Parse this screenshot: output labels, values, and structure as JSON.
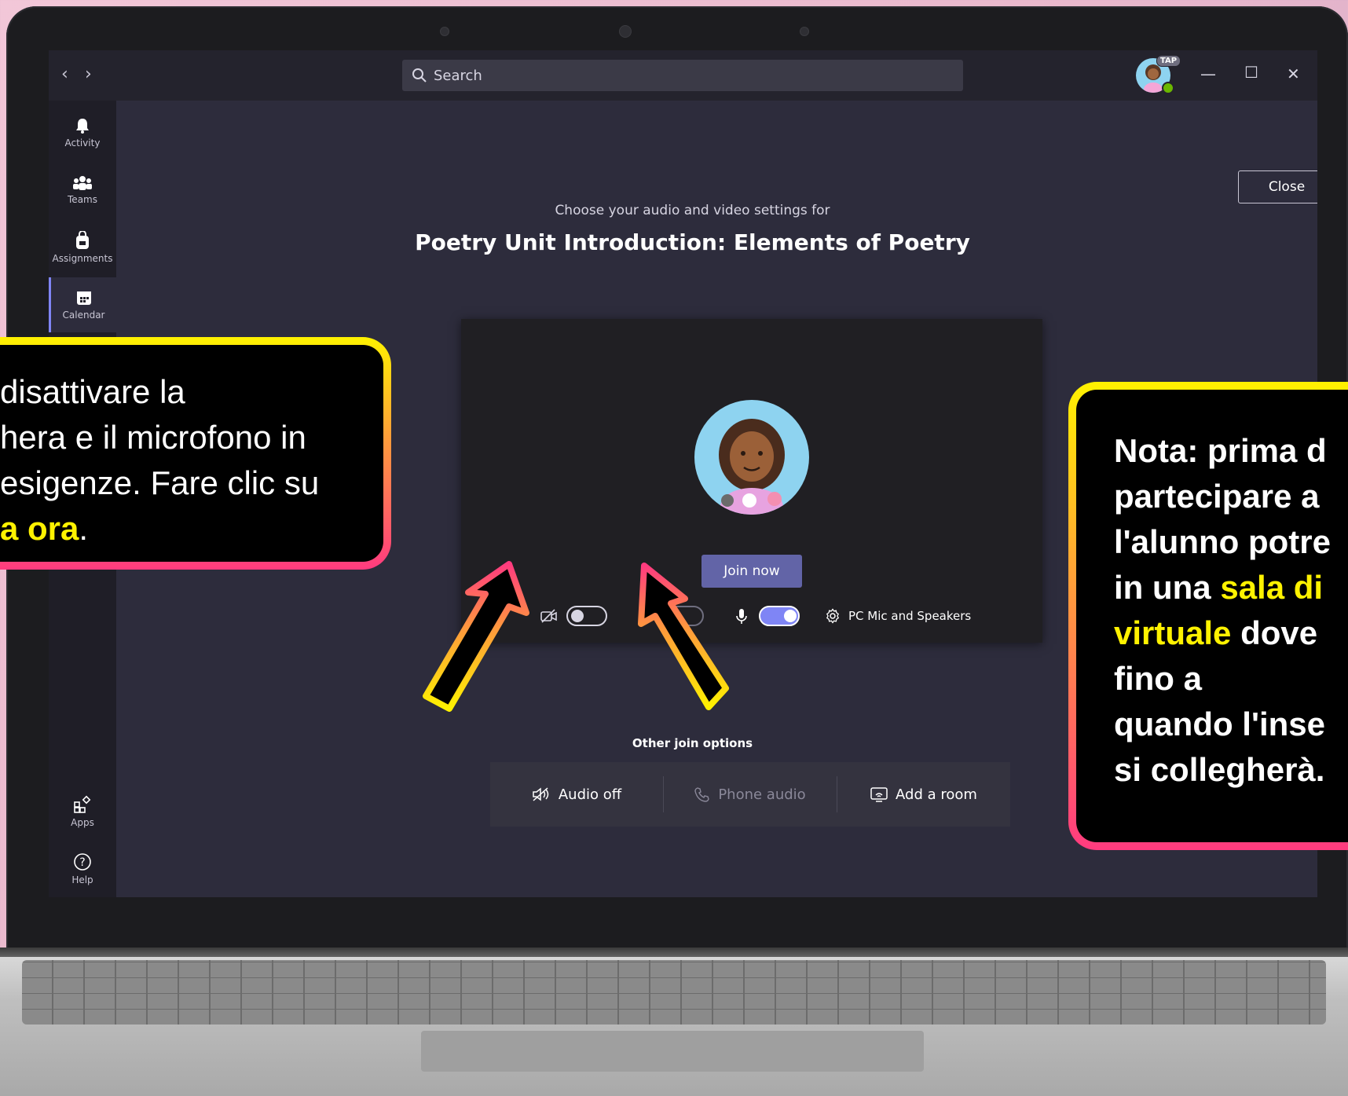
{
  "titlebar": {
    "search_placeholder": "Search",
    "badge": "TAP"
  },
  "rail": {
    "items": [
      {
        "label": "Activity",
        "icon": "bell-icon"
      },
      {
        "label": "Teams",
        "icon": "teams-icon"
      },
      {
        "label": "Assignments",
        "icon": "backpack-icon"
      },
      {
        "label": "Calendar",
        "icon": "calendar-icon",
        "active": true
      }
    ],
    "bottom_items": [
      {
        "label": "Apps",
        "icon": "apps-icon"
      },
      {
        "label": "Help",
        "icon": "help-icon"
      }
    ]
  },
  "prejoin": {
    "close_label": "Close",
    "subtitle": "Choose your audio and video settings for",
    "meeting_title": "Poetry Unit Introduction: Elements of Poetry",
    "join_label": "Join now",
    "camera_on": false,
    "blur_on": false,
    "mic_on": true,
    "device_label": "PC Mic and Speakers",
    "other_title": "Other join options",
    "options": {
      "audio_off": "Audio off",
      "phone_audio": "Phone audio",
      "add_room": "Add a room"
    }
  },
  "callouts": {
    "left": {
      "line1": "disattivare  la",
      "line2": "hera e il  microfono  in",
      "line3": " esigenze.  Fare clic su",
      "highlight": "a ora",
      "end": "."
    },
    "right": {
      "line1": "Nota:  prima  d",
      "line2": "partecipare  a",
      "line3": "l'alunno potre",
      "line4_pre": "in una  ",
      "line4_hl": "sala di",
      "line5_hl": "virtuale",
      "line5_post": " dove",
      "line6": "fino a",
      "line7": "quando  l'inse",
      "line8": "si collegherà."
    }
  },
  "colors": {
    "accent": "#6264a7",
    "toggle_on": "#7f85f5",
    "callout_text_highlight": "#fff200"
  }
}
